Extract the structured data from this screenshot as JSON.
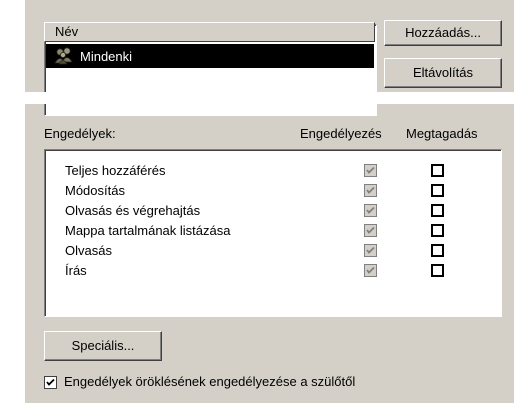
{
  "users_list": {
    "column_header": "Név",
    "selected_item": "Mindenki"
  },
  "buttons": {
    "add": "Hozzáadás...",
    "remove": "Eltávolítás",
    "special": "Speciális..."
  },
  "permissions": {
    "title": "Engedélyek:",
    "allow_col": "Engedélyezés",
    "deny_col": "Megtagadás",
    "items": [
      {
        "name": "Teljes hozzáférés",
        "allow": true,
        "deny": false
      },
      {
        "name": "Módosítás",
        "allow": true,
        "deny": false
      },
      {
        "name": "Olvasás és végrehajtás",
        "allow": true,
        "deny": false
      },
      {
        "name": "Mappa tartalmának listázása",
        "allow": true,
        "deny": false
      },
      {
        "name": "Olvasás",
        "allow": true,
        "deny": false
      },
      {
        "name": "Írás",
        "allow": true,
        "deny": false
      }
    ]
  },
  "inherit": {
    "label": "Engedélyek öröklésének engedélyezése a szülőtől",
    "checked": true
  },
  "colors": {
    "dialog_bg": "#d4d0c8",
    "selection_bg": "#000000",
    "disabled_check": "#808080"
  }
}
